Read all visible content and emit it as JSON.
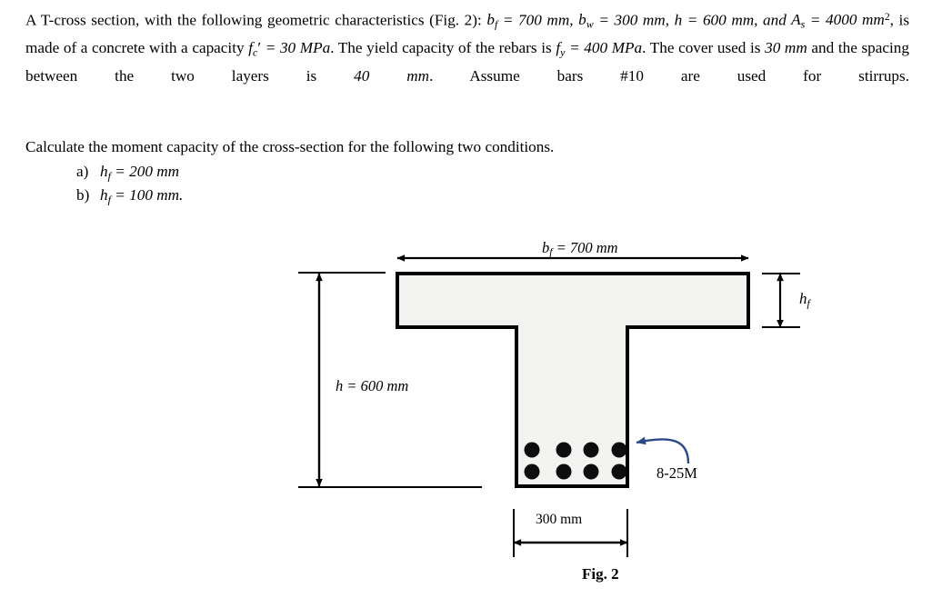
{
  "document": {
    "paragraph1": {
      "line1_a": "A T-cross section, with the following geometric characteristics (Fig. 2): ",
      "sym_bf": "b",
      "sub_f": "f",
      "eq": " = ",
      "val_bf": "700 mm",
      "comma": ", ",
      "sym_bw": "b",
      "sub_w": "w",
      "val_bw": "300 mm",
      "sym_h": "h",
      "val_h": "600 mm",
      "and_text": "and ",
      "sym_As": "A",
      "sub_s": "s",
      "val_As": "4000 mm",
      "sup_2": "2",
      "mid_text": ", is made of a concrete with a capacity ",
      "sym_fc": "f",
      "sub_c": "c",
      "prime": "′",
      "val_fc": "30 MPa",
      "period_the": ". The ",
      "line3_a": "yield capacity of the rebars is ",
      "sym_fy": "f",
      "sub_y": "y",
      "val_fy": "400 MPa",
      "line3_b": ". The cover used is ",
      "val_cover": "30 mm",
      "line3_c": " and the spacing between the ",
      "line4_a": "two layers is ",
      "val_spacing": "40 mm",
      "line4_b": ". Assume bars #10 are used for stirrups."
    },
    "calculate_line": "Calculate the moment capacity of the cross-section for the following two conditions.",
    "conditions": [
      {
        "marker": "a)",
        "sym": "h",
        "sub": "f",
        "eq": " = ",
        "value": "200 mm"
      },
      {
        "marker": "b)",
        "sym": "h",
        "sub": "f",
        "eq": " = ",
        "value": "100 mm."
      }
    ]
  },
  "figure": {
    "caption": "Fig. 2",
    "flange_width_label": {
      "sym": "b",
      "sub": "f",
      "eq": " = ",
      "value": "700 mm"
    },
    "flange_depth_label": {
      "sym": "h",
      "sub": "f"
    },
    "height_label": {
      "sym": "h",
      "eq": " = ",
      "value": "600 mm"
    },
    "web_width_label": "300 mm",
    "rebar_callout": "8-25M",
    "rebar_count": 8,
    "rebar_rows": 2,
    "rebar_cols": 4,
    "colors": {
      "outline": "#000000",
      "concrete_fill": "#f2f2f0",
      "rebar": "#000000",
      "callout_arrow": "#2c4a87",
      "math_subscript": "#c98a3c"
    }
  }
}
